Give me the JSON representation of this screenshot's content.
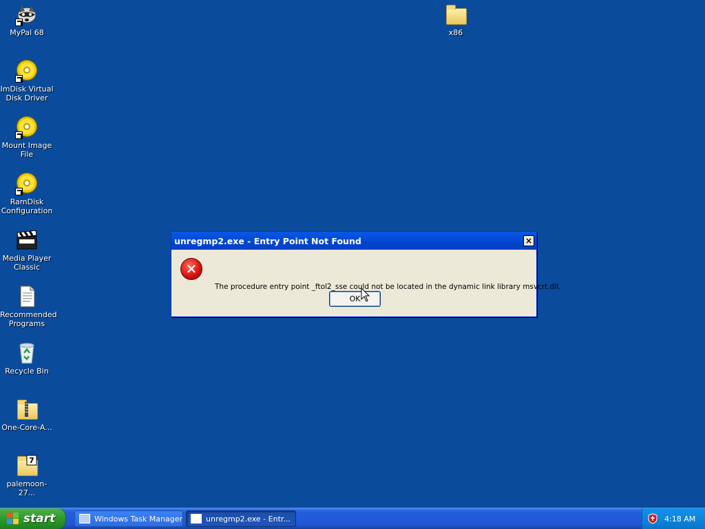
{
  "desktop": {
    "icons": [
      {
        "label": "MyPal 68",
        "icon": "raccoon-app-icon"
      },
      {
        "label": "ImDisk Virtual Disk Driver",
        "icon": "cd-disc-icon"
      },
      {
        "label": "Mount Image File",
        "icon": "cd-disc-icon"
      },
      {
        "label": "RamDisk Configuration",
        "icon": "cd-disc-icon"
      },
      {
        "label": "Media Player Classic",
        "icon": "clapperboard-icon"
      },
      {
        "label": "Recommended Programs",
        "icon": "document-icon"
      },
      {
        "label": "Recycle Bin",
        "icon": "recycle-bin-icon"
      },
      {
        "label": "One-Core-A...",
        "icon": "zip-folder-icon"
      },
      {
        "label": "palemoon-27...",
        "icon": "7zip-archive-icon"
      },
      {
        "label": "x86",
        "icon": "folder-icon"
      }
    ]
  },
  "dialog": {
    "title": "unregmp2.exe - Entry Point Not Found",
    "close_glyph": "×",
    "icon": "error-icon",
    "message": "The procedure entry point _ftol2_sse could not be located in the dynamic link library msvcrt.dll.",
    "ok_label": "OK"
  },
  "taskbar": {
    "start_label": "start",
    "tasks": [
      {
        "label": "Windows Task Manager",
        "active": false
      },
      {
        "label": "unregmp2.exe - Entr...",
        "active": true
      }
    ],
    "clock": "4:18 AM"
  },
  "colors": {
    "desktop_bg": "#0b4b9b",
    "titlebar": "#0045d0",
    "taskbar": "#245edb",
    "start_green": "#2d9b2a"
  }
}
